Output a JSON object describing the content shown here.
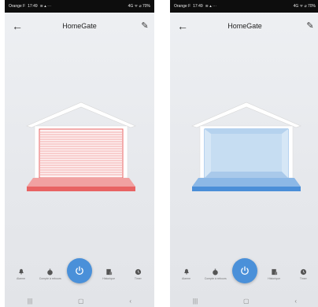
{
  "screens": [
    {
      "status": {
        "carrier": "Orange F",
        "time": "17:49",
        "signal": "≋ ▴ ⋯",
        "right": "4G ᯤ ⌀ 70%"
      },
      "header": {
        "title": "HomeGate"
      },
      "door_state": "closed",
      "door_color": "#e86363",
      "nav": [
        {
          "label": "Alarme",
          "icon": "bell-icon"
        },
        {
          "label": "Compte à rebours",
          "icon": "timer-icon"
        },
        {
          "label": "",
          "icon": "power-icon"
        },
        {
          "label": "Historique",
          "icon": "history-icon"
        },
        {
          "label": "Timer",
          "icon": "clock-icon"
        }
      ]
    },
    {
      "status": {
        "carrier": "Orange F",
        "time": "17:49",
        "signal": "≋ ▴ ⋯",
        "right": "4G ᯤ ⌀ 70%"
      },
      "header": {
        "title": "HomeGate"
      },
      "door_state": "open",
      "door_color": "#4a8ed8",
      "nav": [
        {
          "label": "Alarme",
          "icon": "bell-icon"
        },
        {
          "label": "Compte à rebours",
          "icon": "timer-icon"
        },
        {
          "label": "",
          "icon": "power-icon"
        },
        {
          "label": "Historique",
          "icon": "history-icon"
        },
        {
          "label": "Timer",
          "icon": "clock-icon"
        }
      ]
    }
  ],
  "system_nav": {
    "recents": "|||",
    "home": "▢",
    "back": "‹"
  },
  "colors": {
    "accent": "#4a90d9",
    "closed_door": "#e86363",
    "open_door": "#4a8ed8",
    "open_fill": "#c6ddf2"
  }
}
